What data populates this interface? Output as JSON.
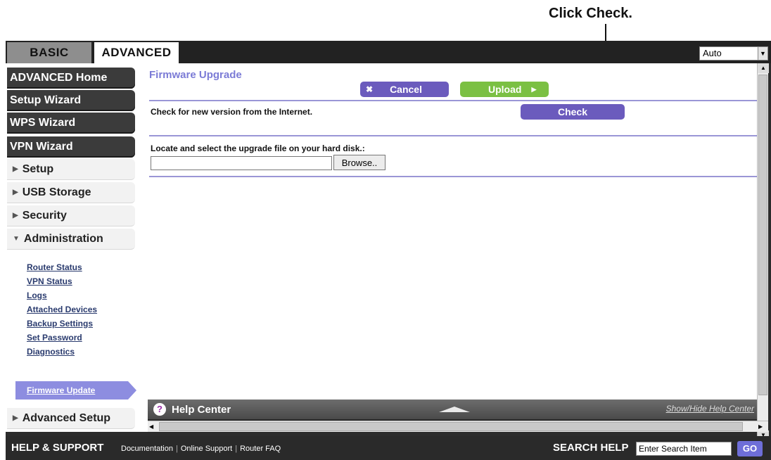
{
  "annotation": {
    "text": "Click Check."
  },
  "tabs": {
    "basic": "BASIC",
    "advanced": "ADVANCED"
  },
  "language": {
    "value": "Auto"
  },
  "sidebar": {
    "advanced_home": "ADVANCED Home",
    "setup_wizard": "Setup Wizard",
    "wps_wizard": "WPS Wizard",
    "vpn_wizard": "VPN Wizard",
    "setup": "Setup",
    "usb_storage": "USB Storage",
    "security": "Security",
    "administration": "Administration",
    "admin_items": [
      "Router Status",
      "VPN Status",
      "Logs",
      "Attached Devices",
      "Backup Settings",
      "Set Password",
      "Diagnostics"
    ],
    "active_item": "Firmware Update",
    "advanced_setup": "Advanced Setup"
  },
  "main": {
    "title": "Firmware Upgrade",
    "cancel_label": "Cancel",
    "upload_label": "Upload",
    "check_text": "Check for new version from the Internet.",
    "check_label": "Check",
    "locate_text": "Locate and select the upgrade file on your hard disk.:",
    "browse_label": "Browse.."
  },
  "help": {
    "label": "Help Center",
    "show_hide": "Show/Hide Help Center"
  },
  "footer": {
    "help_support": "HELP & SUPPORT",
    "links": [
      "Documentation",
      "Online Support",
      "Router FAQ"
    ],
    "search_help": "SEARCH HELP",
    "search_value": "Enter Search Item",
    "go": "GO"
  }
}
